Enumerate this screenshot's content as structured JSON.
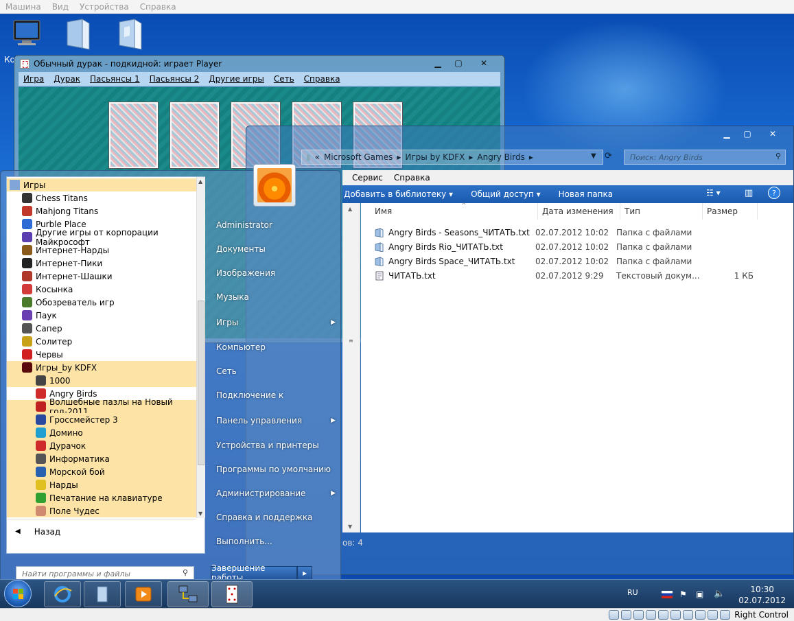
{
  "host_menu": [
    "Машина",
    "Вид",
    "Устройства",
    "Справка"
  ],
  "desktop": {
    "icons": [
      "computer",
      "file",
      "folder"
    ],
    "partial_label": "Ко"
  },
  "durak": {
    "title": "Обычный дурак - подкидной: играет Player",
    "menu": [
      "Игра",
      "Дурак",
      "Пасьянсы 1",
      "Пасьянсы 2",
      "Другие игры",
      "Сеть",
      "Справка"
    ],
    "card_count": 5
  },
  "explorer": {
    "address": [
      "«",
      "Microsoft Games",
      "▸",
      "Игры by KDFX",
      "▸",
      "Angry Birds",
      "▸"
    ],
    "search_placeholder": "Поиск: Angry Birds",
    "menubar": [
      "Сервис",
      "Справка"
    ],
    "toolbar": [
      "Добавить в библиотеку ▾",
      "Общий доступ ▾",
      "Новая папка"
    ],
    "columns": [
      "Имя",
      "Дата изменения",
      "Тип",
      "Размер"
    ],
    "files": [
      {
        "name": "Angry Birds - Seasons_ЧИТАТЬ.txt",
        "date": "02.07.2012 10:02",
        "type": "Папка с файлами",
        "size": "",
        "icon": "folder-icon"
      },
      {
        "name": "Angry Birds Rio_ЧИТАТЬ.txt",
        "date": "02.07.2012 10:02",
        "type": "Папка с файлами",
        "size": "",
        "icon": "folder-icon"
      },
      {
        "name": "Angry Birds Space_ЧИТАТЬ.txt",
        "date": "02.07.2012 10:02",
        "type": "Папка с файлами",
        "size": "",
        "icon": "folder-icon"
      },
      {
        "name": "ЧИТАТЬ.txt",
        "date": "02.07.2012 9:29",
        "type": "Текстовый докум...",
        "size": "1 КБ",
        "icon": "text-file-icon"
      }
    ],
    "status_partial": "ов: 4"
  },
  "startmenu": {
    "programs": [
      {
        "label": "Игры",
        "level": 0,
        "hl": true,
        "color": "#7fa6d6"
      },
      {
        "label": "Chess Titans",
        "level": 1,
        "hl": false,
        "color": "#333333"
      },
      {
        "label": "Mahjong Titans",
        "level": 1,
        "hl": false,
        "color": "#c0392b"
      },
      {
        "label": "Purble Place",
        "level": 1,
        "hl": false,
        "color": "#2d6bd6"
      },
      {
        "label": "Другие игры от корпорации Майкрософт",
        "level": 1,
        "hl": false,
        "color": "#5b3fb0"
      },
      {
        "label": "Интернет-Нарды",
        "level": 1,
        "hl": false,
        "color": "#8a5a1a"
      },
      {
        "label": "Интернет-Пики",
        "level": 1,
        "hl": false,
        "color": "#222222"
      },
      {
        "label": "Интернет-Шашки",
        "level": 1,
        "hl": false,
        "color": "#b0382b"
      },
      {
        "label": "Косынка",
        "level": 1,
        "hl": false,
        "color": "#d33b3b"
      },
      {
        "label": "Обозреватель игр",
        "level": 1,
        "hl": false,
        "color": "#4a7a2a"
      },
      {
        "label": "Паук",
        "level": 1,
        "hl": false,
        "color": "#6a3fb0"
      },
      {
        "label": "Сапер",
        "level": 1,
        "hl": false,
        "color": "#555555"
      },
      {
        "label": "Солитер",
        "level": 1,
        "hl": false,
        "color": "#c9a21a"
      },
      {
        "label": "Червы",
        "level": 1,
        "hl": false,
        "color": "#d02020"
      },
      {
        "label": "Игры_by KDFX",
        "level": 1,
        "hl": true,
        "color": "#5a0a0a"
      },
      {
        "label": "1000",
        "level": 2,
        "hl": true,
        "color": "#444444"
      },
      {
        "label": "Angry Birds",
        "level": 2,
        "hl": false,
        "color": "#d02b2b"
      },
      {
        "label": "Волшебные пазлы на Новый год-2011",
        "level": 2,
        "hl": true,
        "color": "#c02020"
      },
      {
        "label": "Гроссмейстер 3",
        "level": 2,
        "hl": true,
        "color": "#2a4aa0"
      },
      {
        "label": "Домино",
        "level": 2,
        "hl": true,
        "color": "#20a0d0"
      },
      {
        "label": "Дурачок",
        "level": 2,
        "hl": true,
        "color": "#d02b2b"
      },
      {
        "label": "Информатика",
        "level": 2,
        "hl": true,
        "color": "#555555"
      },
      {
        "label": "Морской бой",
        "level": 2,
        "hl": true,
        "color": "#2a60b0"
      },
      {
        "label": "Нарды",
        "level": 2,
        "hl": true,
        "color": "#e0c020"
      },
      {
        "label": "Печатание на клавиатуре",
        "level": 2,
        "hl": true,
        "color": "#30a030"
      },
      {
        "label": "Поле Чудес",
        "level": 2,
        "hl": true,
        "color": "#d08a70"
      }
    ],
    "back_label": "Назад",
    "search_placeholder": "Найти программы и файлы",
    "right_items": [
      {
        "label": "Administrator",
        "arrow": false
      },
      {
        "label": "Документы",
        "arrow": false
      },
      {
        "label": "Изображения",
        "arrow": false
      },
      {
        "label": "Музыка",
        "arrow": false
      },
      {
        "label": "Игры",
        "arrow": true
      },
      {
        "label": "Компьютер",
        "arrow": false
      },
      {
        "label": "Сеть",
        "arrow": false
      },
      {
        "label": "Подключение к",
        "arrow": false
      },
      {
        "label": "Панель управления",
        "arrow": true
      },
      {
        "label": "Устройства и принтеры",
        "arrow": false
      },
      {
        "label": "Программы по умолчанию",
        "arrow": false
      },
      {
        "label": "Администрирование",
        "arrow": true
      },
      {
        "label": "Справка и поддержка",
        "arrow": false
      },
      {
        "label": "Выполнить...",
        "arrow": false
      }
    ],
    "shutdown_label": "Завершение работы"
  },
  "taskbar": {
    "apps": [
      "internet-explorer-icon",
      "explorer-icon",
      "media-player-icon",
      "network-app-icon",
      "durak-app-icon"
    ],
    "lang": "RU",
    "time": "10:30",
    "date": "02.07.2012"
  },
  "hoststatus": {
    "label": "Right Control"
  }
}
